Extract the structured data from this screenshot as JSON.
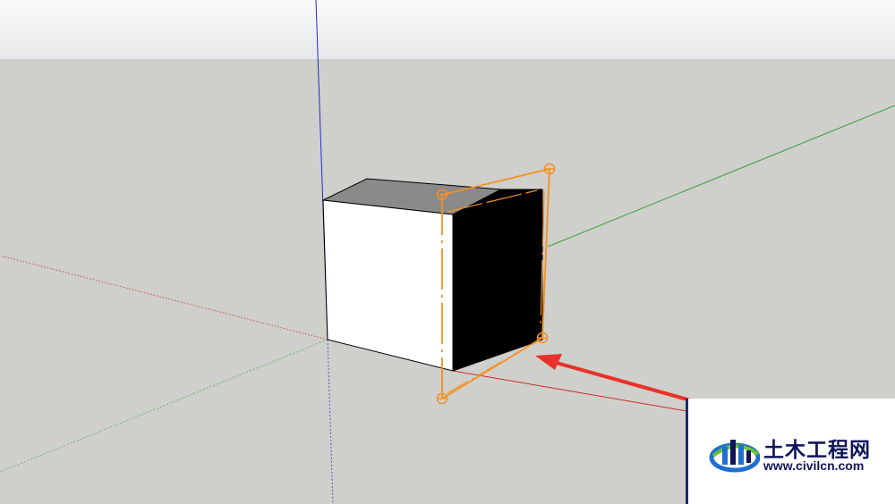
{
  "scene": {
    "sky_color": "#f3f4f4",
    "ground_color": "#cfcfcb",
    "axis_colors": {
      "red": "#d22a2a",
      "green": "#3aa03a",
      "blue": "#2b2bc8"
    },
    "selection_color": "#f59022",
    "arrow_color": "#e8322a",
    "cube_faces": {
      "front": "#ffffff",
      "top": "#8c8c8c",
      "side": "#000000"
    }
  },
  "watermark": {
    "name": "土木工程网",
    "url": "www.civilcn.com",
    "logo_icon": "civilcn-logo-icon",
    "brand_color": "#11145a"
  }
}
